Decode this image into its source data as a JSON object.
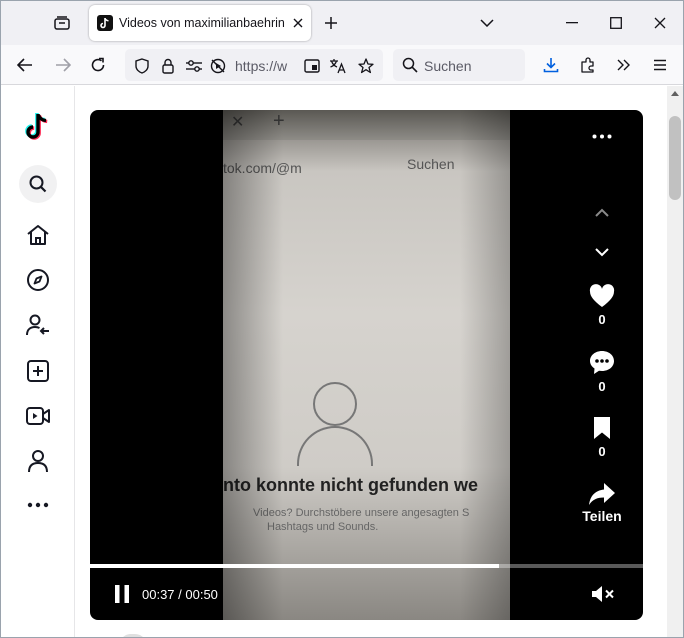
{
  "browser": {
    "tab_title": "Videos von maximilianbaehring",
    "url_text": "https://w",
    "search_placeholder": "Suchen"
  },
  "icons": {
    "tab_favicon": "tiktok-icon",
    "sidebar": [
      "tiktok-logo-icon",
      "search-icon",
      "home-icon",
      "explore-icon",
      "following-icon",
      "upload-icon",
      "live-icon",
      "profile-icon",
      "more-icon"
    ]
  },
  "video": {
    "photo_text": {
      "url": "tok.com/@m",
      "search": "Suchen",
      "message": "nto konnte nicht gefunden we",
      "sub1": "Videos? Durchstöbere unsere angesagten S",
      "sub2": "Hashtags und Sounds."
    },
    "likes": "0",
    "comments": "0",
    "saves": "0",
    "share_label": "Teilen",
    "time": "00:37 / 00:50",
    "progress_fraction": 0.74
  },
  "colors": {
    "accent_blue": "#0060df",
    "video_bg": "#000000"
  }
}
